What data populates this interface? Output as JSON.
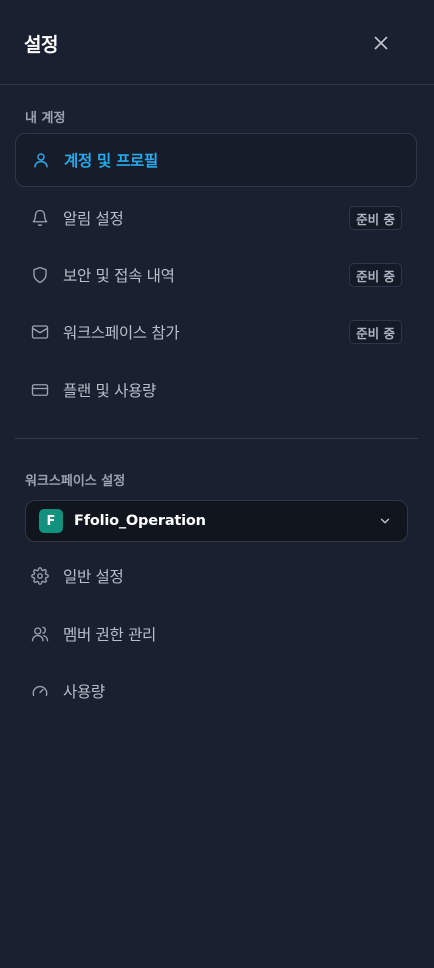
{
  "header": {
    "title": "설정"
  },
  "account_section": {
    "title": "내 계정",
    "items": [
      {
        "label": "계정 및 프로필",
        "icon": "user-icon",
        "active": true,
        "badge": ""
      },
      {
        "label": "알림 설정",
        "icon": "bell-icon",
        "active": false,
        "badge": "준비 중"
      },
      {
        "label": "보안 및 접속 내역",
        "icon": "shield-icon",
        "active": false,
        "badge": "준비 중"
      },
      {
        "label": "워크스페이스 참가",
        "icon": "mail-icon",
        "active": false,
        "badge": "준비 중"
      },
      {
        "label": "플랜 및 사용량",
        "icon": "credit-card-icon",
        "active": false,
        "badge": ""
      }
    ]
  },
  "workspace_section": {
    "title": "워크스페이스 설정",
    "selector": {
      "initial": "F",
      "name": "Ffolio_Operation"
    },
    "items": [
      {
        "label": "일반 설정",
        "icon": "gear-icon"
      },
      {
        "label": "멤버 권한 관리",
        "icon": "users-icon"
      },
      {
        "label": "사용량",
        "icon": "gauge-icon"
      }
    ]
  },
  "colors": {
    "background": "#1a2030",
    "accent": "#2aa7ea",
    "workspace_avatar": "#10927f"
  }
}
